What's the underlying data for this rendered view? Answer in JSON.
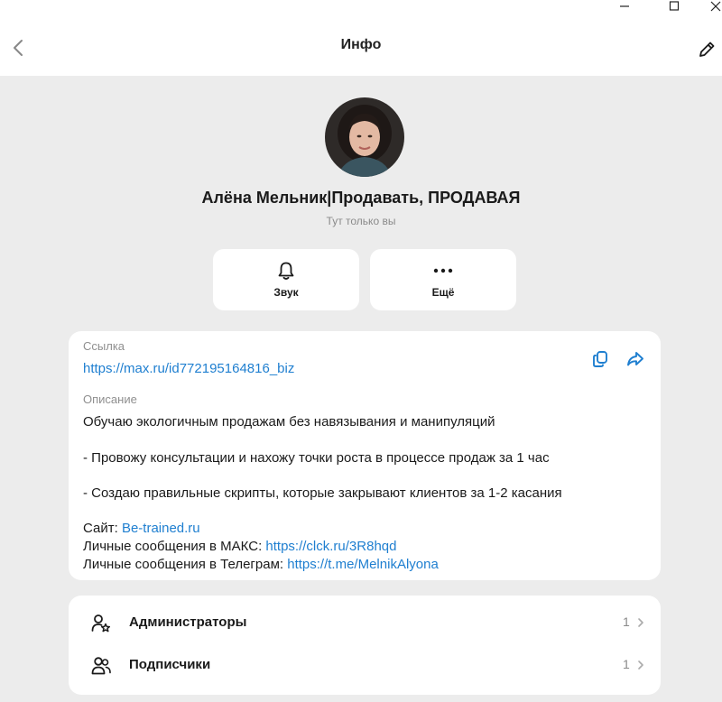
{
  "window": {
    "controls": {
      "minimize_icon": "minimize-icon",
      "maximize_icon": "maximize-icon",
      "close_icon": "close-icon"
    }
  },
  "header": {
    "title": "Инфо",
    "back_icon": "chevron-left-icon",
    "edit_icon": "pencil-icon"
  },
  "profile": {
    "name": "Алёна Мельник|Продавать, ПРОДАВАЯ",
    "subtitle": "Тут только вы"
  },
  "actions": [
    {
      "label": "Звук",
      "icon": "bell-icon"
    },
    {
      "label": "Ещё",
      "icon": "more-icon"
    }
  ],
  "info": {
    "link_label": "Ссылка",
    "link_value": "https://max.ru/id772195164816_biz",
    "description_label": "Описание",
    "description_lines": [
      "Обучаю экологичным продажам без навязывания и манипуляций",
      "- Провожу консультации и нахожу точки роста в процессе продаж за 1 час",
      "- Создаю правильные скрипты, которые закрывают клиентов за 1-2 касания"
    ],
    "site_prefix": "Сайт: ",
    "site_link": "Be-trained.ru",
    "max_prefix": "Личные сообщения в МАКС: ",
    "max_link": "https://clck.ru/3R8hqd",
    "tg_prefix": "Личные сообщения в Телеграм: ",
    "tg_link": "https://t.me/MelnikAlyona"
  },
  "list": [
    {
      "label": "Администраторы",
      "count": "1",
      "icon": "admin-icon"
    },
    {
      "label": "Подписчики",
      "count": "1",
      "icon": "subscribers-icon"
    }
  ],
  "colors": {
    "accent": "#1f7fd0",
    "background": "#ececec",
    "card": "#ffffff"
  }
}
